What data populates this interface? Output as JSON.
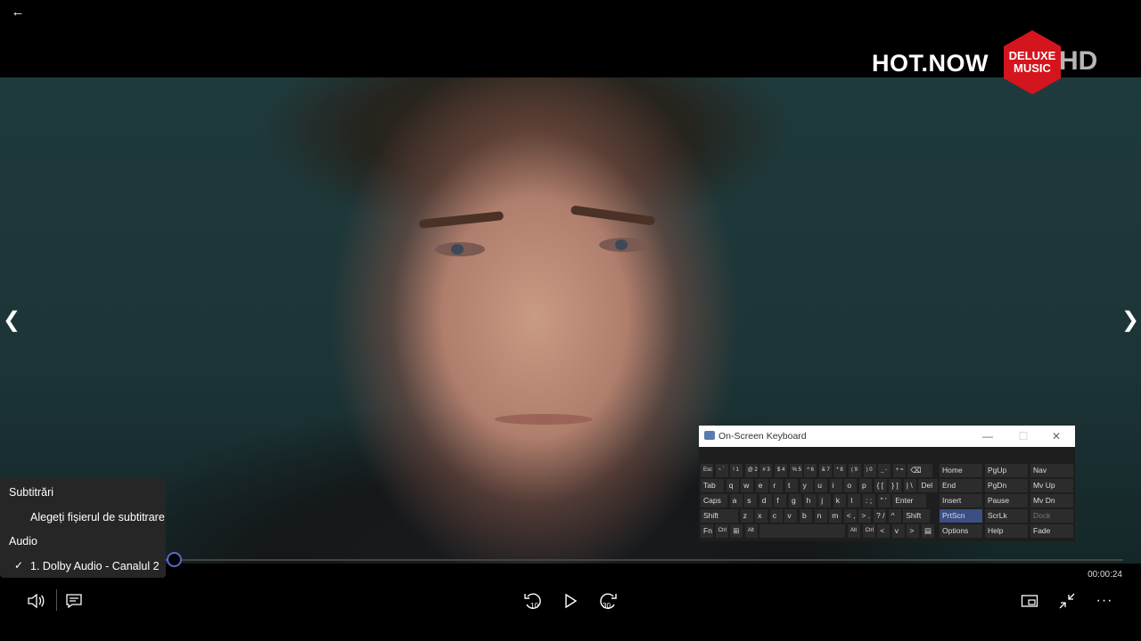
{
  "logo": {
    "text": "HOT.NOW",
    "badge_line1": "DELUXE",
    "badge_line2": "MUSIC",
    "hd": "HD"
  },
  "player": {
    "time": "00:00:24",
    "progress_fraction": 0.155
  },
  "icons": {
    "back": "←",
    "prev": "❮",
    "next": "❯",
    "volume": "🔈",
    "subtitles": "▭",
    "rewind": "10",
    "play": "▷",
    "forward": "30",
    "miniview": "▣",
    "exit_fullscreen": "⤡",
    "more": "···"
  },
  "menu": {
    "subtitles_header": "Subtitrări",
    "choose_subtitle_file": "Alegeți fișierul de subtitrare",
    "audio_header": "Audio",
    "audio_track": "1. Dolby Audio - Canalul 2",
    "check": "✓"
  },
  "osk": {
    "title": "On-Screen Keyboard",
    "minimize": "—",
    "maximize": "☐",
    "close": "✕",
    "row1": [
      "Esc",
      "~ `",
      "! 1",
      "@ 2",
      "# 3",
      "$ 4",
      "% 5",
      "^ 6",
      "& 7",
      "* 8",
      "( 9",
      ") 0",
      "_ -",
      "+ =",
      "⌫"
    ],
    "row2": [
      "Tab",
      "q",
      "w",
      "e",
      "r",
      "t",
      "y",
      "u",
      "i",
      "o",
      "p",
      "{ [",
      "} ]",
      "| \\",
      "Del"
    ],
    "row3": [
      "Caps",
      "a",
      "s",
      "d",
      "f",
      "g",
      "h",
      "j",
      "k",
      "l",
      ": ;",
      "\" '",
      "Enter"
    ],
    "row4": [
      "Shift",
      "z",
      "x",
      "c",
      "v",
      "b",
      "n",
      "m",
      "< ,",
      "> .",
      "? /",
      "^",
      "Shift"
    ],
    "row5": [
      "Fn",
      "Ctrl",
      "⊞",
      "Alt",
      "",
      "Alt",
      "Ctrl",
      "<",
      "v",
      ">",
      "▤"
    ],
    "nav": [
      [
        "Home",
        "PgUp",
        "Nav"
      ],
      [
        "End",
        "PgDn",
        "Mv Up"
      ],
      [
        "Insert",
        "Pause",
        "Mv Dn"
      ],
      [
        "PrtScn",
        "ScrLk",
        "Dock"
      ],
      [
        "Options",
        "Help",
        "Fade"
      ]
    ]
  }
}
